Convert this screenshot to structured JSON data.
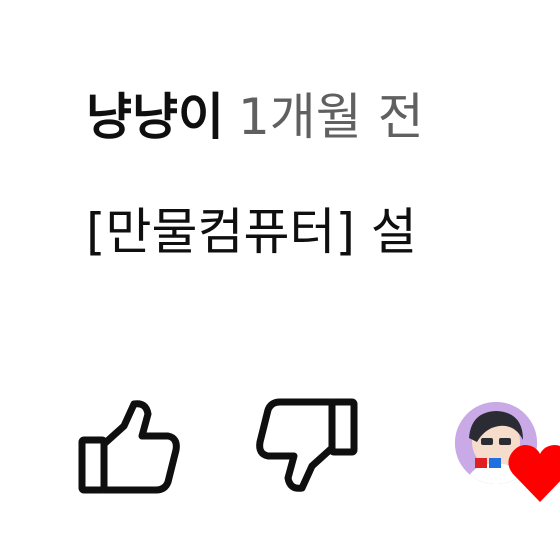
{
  "comment": {
    "author": "냥냥이",
    "timestamp": "1개월 전",
    "text": "[만물컴퓨터] 설"
  },
  "actions": {
    "like_icon": "thumbs-up-outline-icon",
    "dislike_icon": "thumbs-down-outline-icon"
  },
  "creator_heart": {
    "avatar_icon": "creator-avatar",
    "heart_icon": "heart-icon",
    "heart_color": "#ff0000"
  },
  "colors": {
    "text_primary": "#0f0f0f",
    "text_secondary": "#606060",
    "avatar_bg": "#c9a9e6"
  }
}
